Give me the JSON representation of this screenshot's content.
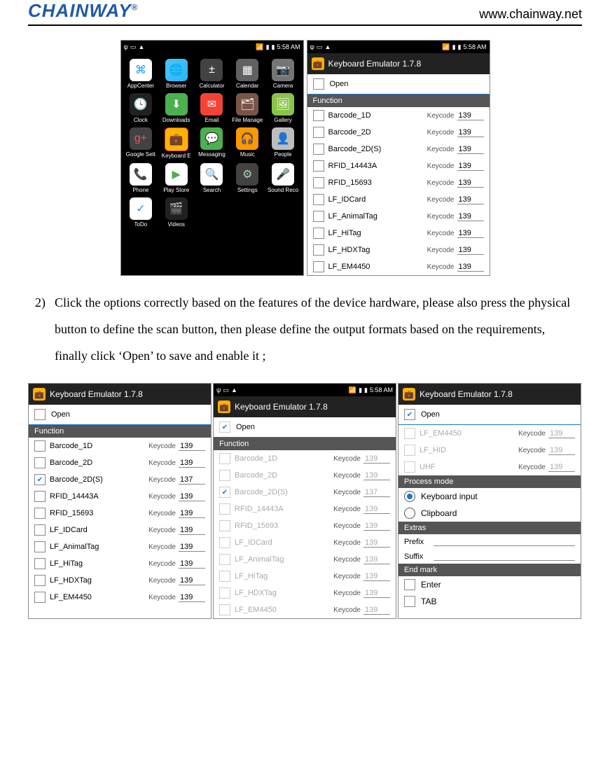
{
  "header": {
    "logo": "CHAINWAY",
    "reg": "®",
    "url": "www.chainway.net"
  },
  "status": {
    "time": "5:58 AM"
  },
  "home_apps": [
    {
      "label": "AppCenter",
      "cls": "i-appcenter",
      "glyph": "⌘"
    },
    {
      "label": "Browser",
      "cls": "i-browser",
      "glyph": "🌐"
    },
    {
      "label": "Calculator",
      "cls": "i-calc",
      "glyph": "±"
    },
    {
      "label": "Calendar",
      "cls": "i-cal",
      "glyph": "▦"
    },
    {
      "label": "Camera",
      "cls": "i-cam",
      "glyph": "📷"
    },
    {
      "label": "Clock",
      "cls": "i-clock",
      "glyph": "🕓"
    },
    {
      "label": "Downloads",
      "cls": "i-dl",
      "glyph": "⬇"
    },
    {
      "label": "Email",
      "cls": "i-email",
      "glyph": "✉"
    },
    {
      "label": "File Manage",
      "cls": "i-file",
      "glyph": "🗂"
    },
    {
      "label": "Gallery",
      "cls": "i-gallery",
      "glyph": "🖼"
    },
    {
      "label": "Google Sett",
      "cls": "i-gset",
      "glyph": "g+"
    },
    {
      "label": "Keyboard E",
      "cls": "i-kbe",
      "glyph": "💼"
    },
    {
      "label": "Messaging",
      "cls": "i-msg",
      "glyph": "💬"
    },
    {
      "label": "Music",
      "cls": "i-music",
      "glyph": "🎧"
    },
    {
      "label": "People",
      "cls": "i-people",
      "glyph": "👤"
    },
    {
      "label": "Phone",
      "cls": "i-phone",
      "glyph": "📞"
    },
    {
      "label": "Play Store",
      "cls": "i-play",
      "glyph": "▶"
    },
    {
      "label": "Search",
      "cls": "i-search",
      "glyph": "🔍"
    },
    {
      "label": "Settings",
      "cls": "i-settings",
      "glyph": "⚙"
    },
    {
      "label": "Sound Reco",
      "cls": "i-sound",
      "glyph": "🎤"
    },
    {
      "label": "ToDo",
      "cls": "i-todo",
      "glyph": "✓"
    },
    {
      "label": "Videos",
      "cls": "i-videos",
      "glyph": "🎬"
    }
  ],
  "emu": {
    "title": "Keyboard Emulator  1.7.8",
    "open": "Open",
    "function_hdr": "Function",
    "process_hdr": "Process mode",
    "extras_hdr": "Extras",
    "endmark_hdr": "End mark",
    "keycode_lbl": "Keycode",
    "process_modes": [
      {
        "label": "Keyboard input",
        "sel": true
      },
      {
        "label": "Clipboard",
        "sel": false
      }
    ],
    "extras": [
      {
        "label": "Prefix"
      },
      {
        "label": "Suffix"
      }
    ],
    "endmarks": [
      {
        "label": "Enter",
        "checked": false
      },
      {
        "label": "TAB",
        "checked": false
      }
    ]
  },
  "screen_a_funcs": [
    {
      "name": "Barcode_1D",
      "code": "139",
      "checked": false
    },
    {
      "name": "Barcode_2D",
      "code": "139",
      "checked": false
    },
    {
      "name": "Barcode_2D(S)",
      "code": "139",
      "checked": false
    },
    {
      "name": "RFID_14443A",
      "code": "139",
      "checked": false
    },
    {
      "name": "RFID_15693",
      "code": "139",
      "checked": false
    },
    {
      "name": "LF_IDCard",
      "code": "139",
      "checked": false
    },
    {
      "name": "LF_AnimalTag",
      "code": "139",
      "checked": false
    },
    {
      "name": "LF_HiTag",
      "code": "139",
      "checked": false
    },
    {
      "name": "LF_HDXTag",
      "code": "139",
      "checked": false
    },
    {
      "name": "LF_EM4450",
      "code": "139",
      "checked": false
    }
  ],
  "screen_b_funcs": [
    {
      "name": "Barcode_1D",
      "code": "139",
      "checked": false
    },
    {
      "name": "Barcode_2D",
      "code": "139",
      "checked": false
    },
    {
      "name": "Barcode_2D(S)",
      "code": "137",
      "checked": true
    },
    {
      "name": "RFID_14443A",
      "code": "139",
      "checked": false
    },
    {
      "name": "RFID_15693",
      "code": "139",
      "checked": false
    },
    {
      "name": "LF_IDCard",
      "code": "139",
      "checked": false
    },
    {
      "name": "LF_AnimalTag",
      "code": "139",
      "checked": false
    },
    {
      "name": "LF_HiTag",
      "code": "139",
      "checked": false
    },
    {
      "name": "LF_HDXTag",
      "code": "139",
      "checked": false
    },
    {
      "name": "LF_EM4450",
      "code": "139",
      "checked": false
    }
  ],
  "screen_c_funcs": [
    {
      "name": "Barcode_1D",
      "code": "139",
      "checked": false
    },
    {
      "name": "Barcode_2D",
      "code": "139",
      "checked": false
    },
    {
      "name": "Barcode_2D(S)",
      "code": "137",
      "checked": true
    },
    {
      "name": "RFID_14443A",
      "code": "139",
      "checked": false
    },
    {
      "name": "RFID_15693",
      "code": "139",
      "checked": false
    },
    {
      "name": "LF_IDCard",
      "code": "139",
      "checked": false
    },
    {
      "name": "LF_AnimalTag",
      "code": "139",
      "checked": false
    },
    {
      "name": "LF_HiTag",
      "code": "139",
      "checked": false
    },
    {
      "name": "LF_HDXTag",
      "code": "139",
      "checked": false
    },
    {
      "name": "LF_EM4450",
      "code": "139",
      "checked": false
    }
  ],
  "screen_d_funcs": [
    {
      "name": "LF_EM4450",
      "code": "139",
      "checked": false
    },
    {
      "name": "LF_HID",
      "code": "139",
      "checked": false
    },
    {
      "name": "UHF",
      "code": "139",
      "checked": false
    }
  ],
  "instruction": {
    "num": "2)",
    "text": "Click the options correctly based on the features of the device hardware, please also press the physical button to define the scan button, then please define the output formats based on the requirements, finally click ‘Open’ to save and enable it ;"
  }
}
